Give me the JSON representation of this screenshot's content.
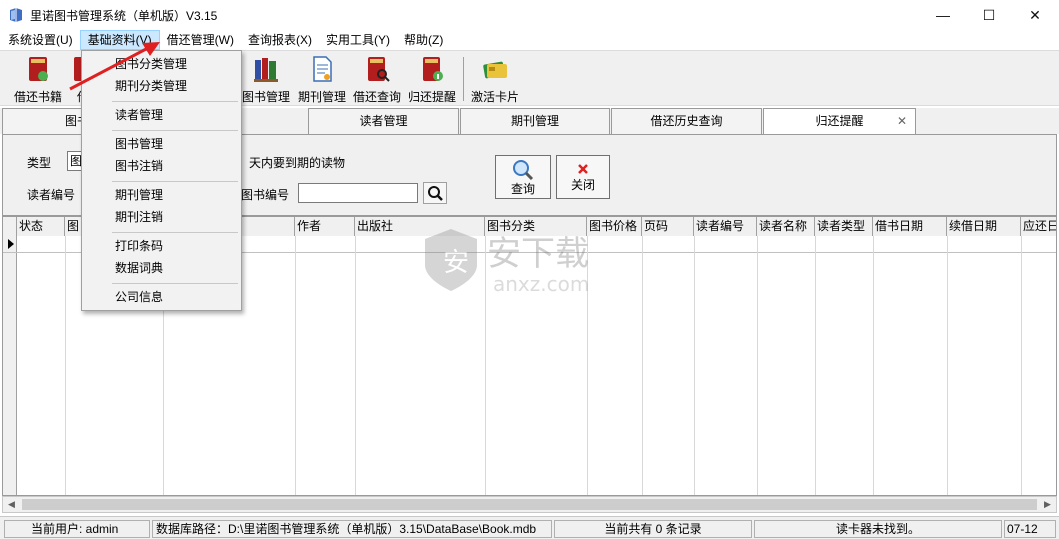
{
  "window": {
    "title": "里诺图书管理系统（单机版）V3.15",
    "minimize": "—",
    "maximize": "☐",
    "close": "✕"
  },
  "menubar": [
    {
      "label": "系统设置(U)"
    },
    {
      "label": "基础资料(V)"
    },
    {
      "label": "借还管理(W)"
    },
    {
      "label": "查询报表(X)"
    },
    {
      "label": "实用工具(Y)"
    },
    {
      "label": "帮助(Z)"
    }
  ],
  "toolbar": {
    "borrow_return": "借还书籍",
    "borrow_return_partial": "借",
    "book_mgmt": "图书管理",
    "journal_mgmt": "期刊管理",
    "history_query": "借还查询",
    "return_reminder": "归还提醒",
    "activate_card": "激活卡片"
  },
  "tabs": {
    "first_partial": "图书",
    "reader": "读者管理",
    "journal": "期刊管理",
    "history": "借还历史查询",
    "reminder": "归还提醒",
    "reminder_close": "✕"
  },
  "filter": {
    "type_label": "类型",
    "type_value": "图",
    "due_text": "天内要到期的读物",
    "reader_no_label": "读者编号",
    "book_no_label": "图书编号",
    "query_button": "查询",
    "close_button": "关闭"
  },
  "grid": {
    "columns": [
      "状态",
      "图",
      "作者",
      "出版社",
      "图书分类",
      "图书价格",
      "页码",
      "读者编号",
      "读者名称",
      "读者类型",
      "借书日期",
      "续借日期",
      "应还日"
    ]
  },
  "dropdown": {
    "items": [
      "图书分类管理",
      "期刊分类管理",
      "读者管理",
      "图书管理",
      "图书注销",
      "期刊管理",
      "期刊注销",
      "打印条码",
      "数据词典",
      "公司信息"
    ]
  },
  "statusbar": {
    "user": "当前用户: admin",
    "db_path": "数据库路径：D:\\里诺图书管理系统（单机版）3.15\\DataBase\\Book.mdb",
    "records": "当前共有 0 条记录",
    "card_reader": "读卡器未找到。",
    "date": "07-12"
  },
  "watermark": {
    "brand": "安下载",
    "url": "anxz.com"
  },
  "colors": {
    "menu_highlight": "#cce8ff",
    "accent_red": "#e02020"
  }
}
